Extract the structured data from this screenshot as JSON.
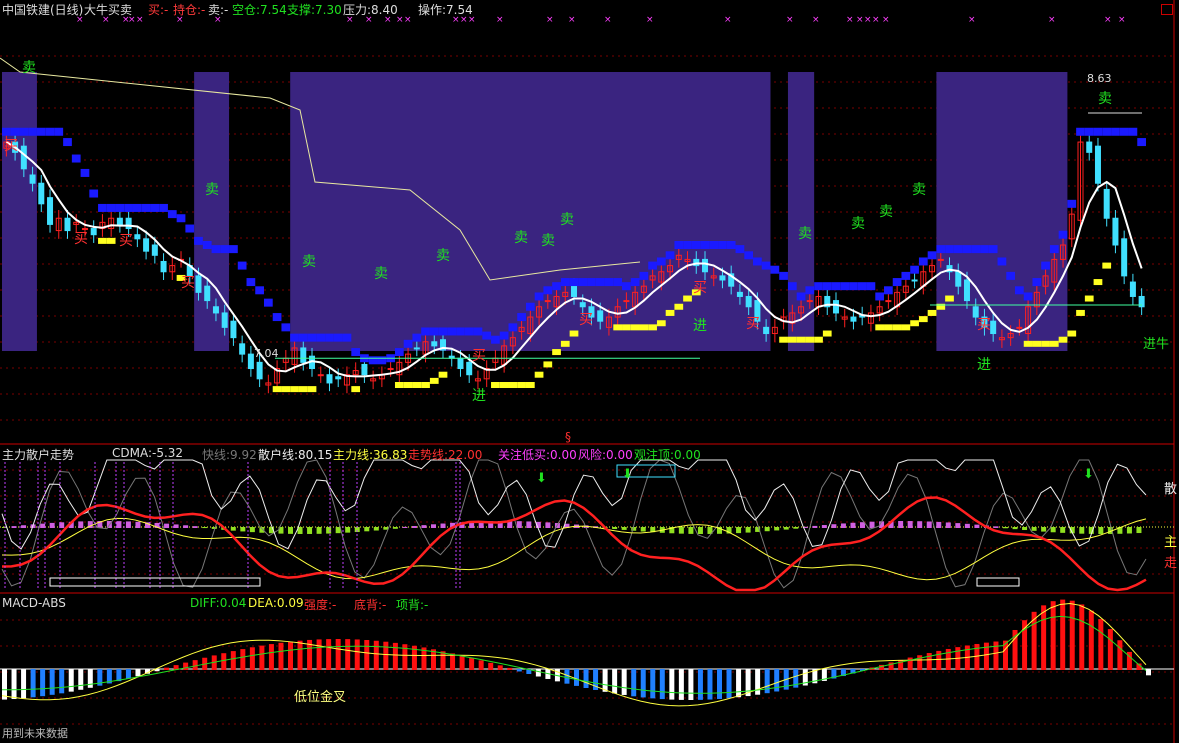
{
  "header": {
    "title": "中国铁建(日线)",
    "strategy": "大牛买卖",
    "buy": "买:-",
    "hold": "持仓:-",
    "sell": "卖:-",
    "short_pos": "空仓:7.54",
    "support": "支撑:7.30",
    "pressure": "压力:8.40",
    "operation": "操作:7.54"
  },
  "main_panel": {
    "high_label": "8.63",
    "low_label": "7.04",
    "marker": "§",
    "signals": {
      "sell": "卖",
      "buy": "买",
      "enter": "进",
      "enter_bull": "进牛"
    }
  },
  "indicator1": {
    "name": "主力散户走势",
    "cdma": "CDMA:-5.32",
    "fast": "快线:9.92",
    "retail": "散户线:80.15",
    "main": "主力线:36.83",
    "trend": "走势线:22.00",
    "watch_low_buy": "关注低买:0.00",
    "risk": "风险:0.00",
    "watch_top": "观注顶:0.00",
    "right_labels": [
      "散",
      "主",
      "走"
    ]
  },
  "indicator2": {
    "name": "MACD-ABS",
    "diff": "DIFF:0.04",
    "dea": "DEA:0.09",
    "strength": "强度:-",
    "bottom_div": "底背:-",
    "top_div": "项背:-",
    "annotation": "低位金叉"
  },
  "footer": {
    "hint": "用到未来数据"
  },
  "colors": {
    "up": "#ff2020",
    "down": "#40e0ff",
    "zone": "#3a2480",
    "grid": "#7a0000"
  },
  "chart_data": {
    "type": "candlestick",
    "title": "中国铁建(日线)",
    "ylim": [
      7.0,
      8.7
    ],
    "close": [
      8.35,
      8.3,
      8.22,
      8.15,
      8.05,
      7.95,
      7.98,
      7.92,
      7.96,
      7.93,
      7.9,
      7.96,
      7.98,
      7.95,
      7.93,
      7.88,
      7.82,
      7.8,
      7.72,
      7.75,
      7.78,
      7.7,
      7.62,
      7.58,
      7.52,
      7.45,
      7.4,
      7.32,
      7.25,
      7.2,
      7.18,
      7.25,
      7.3,
      7.35,
      7.28,
      7.25,
      7.22,
      7.18,
      7.2,
      7.22,
      7.24,
      7.22,
      7.2,
      7.22,
      7.25,
      7.28,
      7.32,
      7.35,
      7.38,
      7.36,
      7.34,
      7.3,
      7.25,
      7.22,
      7.2,
      7.25,
      7.3,
      7.36,
      7.4,
      7.45,
      7.5,
      7.55,
      7.58,
      7.6,
      7.62,
      7.6,
      7.55,
      7.5,
      7.48,
      7.5,
      7.55,
      7.58,
      7.62,
      7.65,
      7.7,
      7.72,
      7.75,
      7.8,
      7.78,
      7.75,
      7.72,
      7.7,
      7.68,
      7.65,
      7.6,
      7.55,
      7.48,
      7.42,
      7.45,
      7.5,
      7.52,
      7.55,
      7.58,
      7.6,
      7.55,
      7.52,
      7.5,
      7.48,
      7.5,
      7.52,
      7.55,
      7.58,
      7.62,
      7.65,
      7.68,
      7.72,
      7.75,
      7.78,
      7.72,
      7.65,
      7.58,
      7.5,
      7.45,
      7.42,
      7.4,
      7.42,
      7.45,
      7.55,
      7.62,
      7.7,
      7.78,
      7.85,
      8.0,
      8.35,
      8.3,
      8.15,
      7.98,
      7.85,
      7.7,
      7.6,
      7.55
    ],
    "support": 7.3,
    "pressure": 8.4
  }
}
